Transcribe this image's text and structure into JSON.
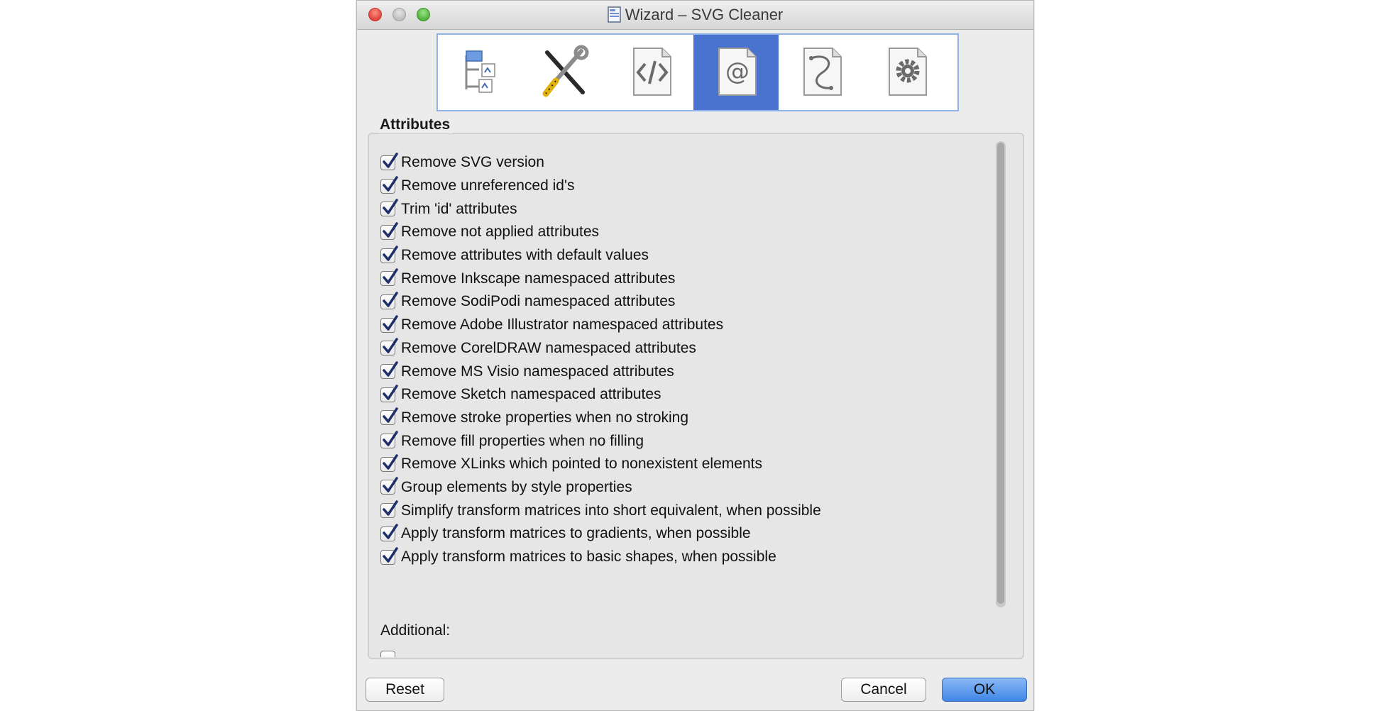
{
  "window": {
    "title": "Wizard – SVG Cleaner"
  },
  "toolbar": {
    "pages": [
      {
        "icon": "tree-structure-icon",
        "active": false
      },
      {
        "icon": "tools-icon",
        "active": false
      },
      {
        "icon": "code-page-icon",
        "active": false
      },
      {
        "icon": "at-sign-page-icon",
        "active": true
      },
      {
        "icon": "bezier-path-page-icon",
        "active": false
      },
      {
        "icon": "gear-page-icon",
        "active": false
      }
    ],
    "active_color": "#4a72cf"
  },
  "group": {
    "title": "Attributes"
  },
  "options": [
    {
      "label": "Remove SVG version",
      "checked": true
    },
    {
      "label": "Remove unreferenced id's",
      "checked": true
    },
    {
      "label": "Trim 'id' attributes",
      "checked": true
    },
    {
      "label": "Remove not applied attributes",
      "checked": true
    },
    {
      "label": "Remove attributes with default values",
      "checked": true
    },
    {
      "label": "Remove Inkscape namespaced attributes",
      "checked": true
    },
    {
      "label": "Remove SodiPodi namespaced attributes",
      "checked": true
    },
    {
      "label": "Remove Adobe Illustrator namespaced attributes",
      "checked": true
    },
    {
      "label": "Remove CorelDRAW namespaced attributes",
      "checked": true
    },
    {
      "label": "Remove MS Visio namespaced attributes",
      "checked": true
    },
    {
      "label": "Remove Sketch namespaced attributes",
      "checked": true
    },
    {
      "label": "Remove stroke properties when no stroking",
      "checked": true
    },
    {
      "label": "Remove fill properties when no filling",
      "checked": true
    },
    {
      "label": "Remove XLinks which pointed to nonexistent elements",
      "checked": true
    },
    {
      "label": "Group elements by style properties",
      "checked": true
    },
    {
      "label": "Simplify transform matrices into short equivalent, when possible",
      "checked": true
    },
    {
      "label": "Apply transform matrices to gradients, when possible",
      "checked": true
    },
    {
      "label": "Apply transform matrices to basic shapes, when possible",
      "checked": true
    }
  ],
  "additional": {
    "label": "Additional:"
  },
  "buttons": {
    "reset": "Reset",
    "cancel": "Cancel",
    "ok": "OK"
  }
}
